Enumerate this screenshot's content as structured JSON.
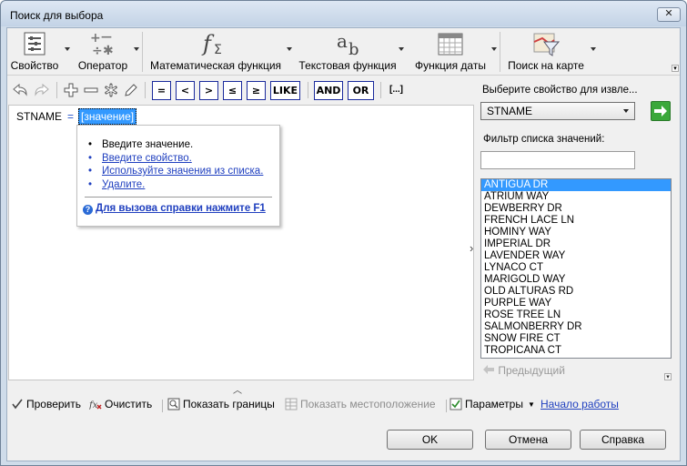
{
  "window": {
    "title": "Поиск для выбора",
    "close_glyph": "✕"
  },
  "ribbon": {
    "property": "Свойство",
    "operator": "Оператор",
    "math_function": "Математическая функция",
    "text_function": "Текстовая функция",
    "date_function": "Функция даты",
    "map_search": "Поиск на карте"
  },
  "operators": {
    "eq": "=",
    "lt": "<",
    "gt": ">",
    "le": "≤",
    "ge": "≥",
    "like": "LIKE",
    "and": "AND",
    "or": "OR",
    "more": "[...]"
  },
  "expression": {
    "property": "STNAME",
    "operator": "=",
    "value": "[значение]"
  },
  "popup": {
    "items": [
      "Введите значение.",
      "Введите свойство.",
      "Используйте значения из списка.",
      "Удалите."
    ],
    "help": "Для вызова справки нажмите F1"
  },
  "right_panel": {
    "select_label": "Выберите свойство для извле...",
    "selected_property": "STNAME",
    "filter_label": "Фильтр списка значений:",
    "filter_value": "",
    "values": [
      "ANTIGUA DR",
      "ATRIUM WAY",
      "DEWBERRY DR",
      "FRENCH LACE LN",
      "HOMINY WAY",
      "IMPERIAL DR",
      "LAVENDER WAY",
      "LYNACO CT",
      "MARIGOLD WAY",
      "OLD ALTURAS RD",
      "PURPLE WAY",
      "ROSE TREE LN",
      "SALMONBERRY DR",
      "SNOW FIRE CT",
      "TROPICANA CT"
    ],
    "selected_value": "ANTIGUA DR",
    "previous": "Предыдущий"
  },
  "commands": {
    "check": "Проверить",
    "clear": "Очистить",
    "show_bounds": "Показать границы",
    "show_location": "Показать местоположение",
    "parameters": "Параметры",
    "getting_started": "Начало работы"
  },
  "buttons": {
    "ok": "OK",
    "cancel": "Отмена",
    "help": "Справка"
  },
  "colors": {
    "selection": "#3399ff",
    "link": "#1f3fbf",
    "operator_border": "#1a2a9c",
    "go_button": "#3aa83a"
  },
  "icons": {
    "ribbon": [
      "property-list-icon",
      "operator-icon",
      "math-function-icon",
      "text-function-icon",
      "calendar-icon",
      "map-search-icon"
    ],
    "toolbar": [
      "undo-icon",
      "redo-icon",
      "plus-icon",
      "minus-icon",
      "asterisk-icon",
      "pencil-icon"
    ]
  }
}
